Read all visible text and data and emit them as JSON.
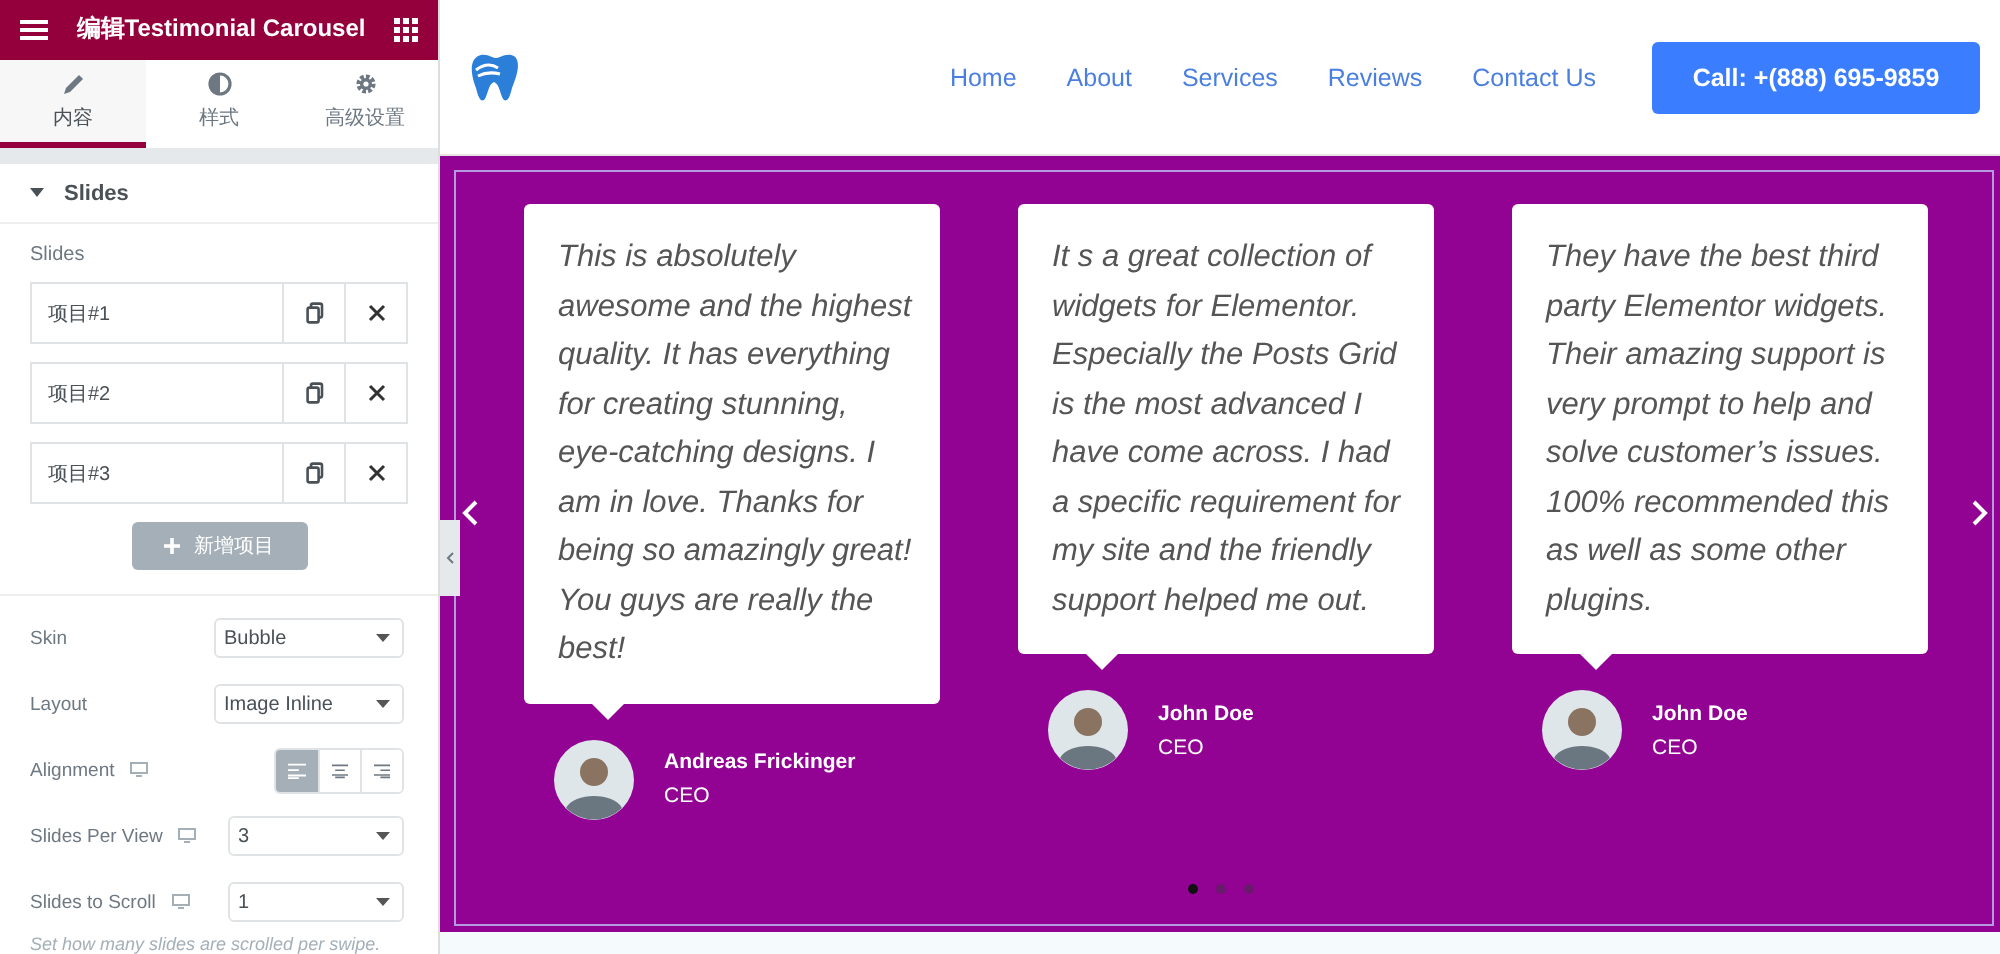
{
  "panel": {
    "title": "编辑Testimonial Carousel",
    "tabs": [
      {
        "label": "内容",
        "selected": true
      },
      {
        "label": "样式",
        "selected": false
      },
      {
        "label": "高级设置",
        "selected": false
      }
    ],
    "section": {
      "title": "Slides",
      "expanded": true
    },
    "repeater_label": "Slides",
    "items": [
      {
        "label": "项目#1"
      },
      {
        "label": "项目#2"
      },
      {
        "label": "项目#3"
      }
    ],
    "add_button": "新增项目",
    "controls": [
      {
        "kind": "select",
        "label": "Skin",
        "value": "Bubble",
        "responsive": false
      },
      {
        "kind": "select",
        "label": "Layout",
        "value": "Image Inline",
        "responsive": false
      },
      {
        "kind": "align",
        "label": "Alignment",
        "responsive": true,
        "options": [
          {
            "selected": true
          },
          {
            "selected": false
          },
          {
            "selected": false
          }
        ]
      },
      {
        "kind": "select",
        "label": "Slides Per View",
        "value": "3",
        "responsive": true
      },
      {
        "kind": "select",
        "label": "Slides to Scroll",
        "value": "1",
        "responsive": true
      }
    ],
    "help": "Set how many slides are scrolled per swipe."
  },
  "site": {
    "nav": [
      "Home",
      "About",
      "Services",
      "Reviews",
      "Contact Us"
    ],
    "cta": "Call: +(888) 695-9859"
  },
  "slides": [
    {
      "text": "This is absolutely awesome and the highest quality. It has everything for creating stunning, eye-catching designs. I am in love. Thanks for being so amazingly great! You guys are really the best!",
      "name": "Andreas Frickinger",
      "title": "CEO"
    },
    {
      "text": "It s a great collection of widgets for Elementor. Especially the Posts Grid is the most advanced I have come across. I had a specific requirement for my site and the friendly support helped me out.",
      "name": "John Doe",
      "title": "CEO"
    },
    {
      "text": "They have the best third party Elementor widgets. Their amazing support is very prompt to help and solve customer’s issues. 100% recommended this as well as some other plugins.",
      "name": "John Doe",
      "title": "CEO"
    }
  ],
  "dots": [
    {
      "selected": true
    },
    {
      "selected": false
    },
    {
      "selected": false
    }
  ]
}
